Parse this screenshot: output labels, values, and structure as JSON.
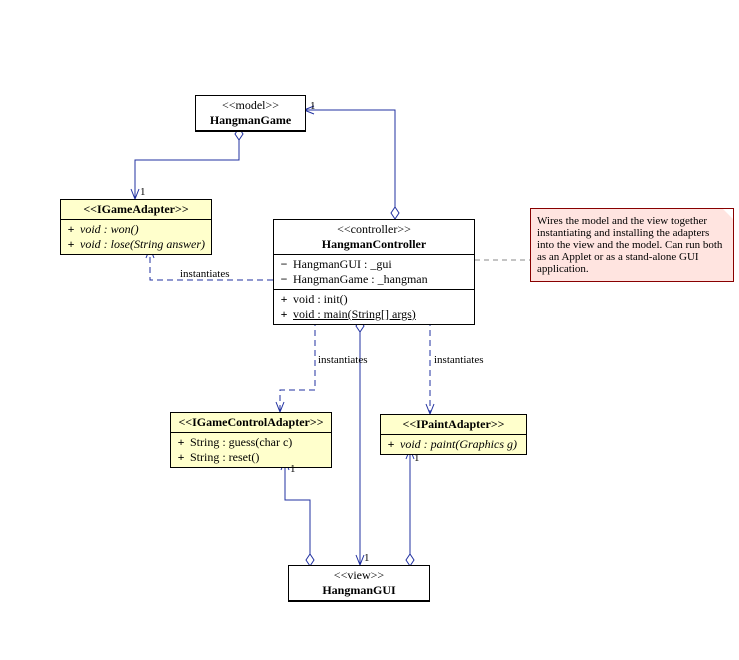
{
  "chart_data": {
    "type": "uml-class-diagram",
    "classes": [
      {
        "id": "HangmanGame",
        "stereotype": "model",
        "sections": [],
        "interface": false
      },
      {
        "id": "HangmanController",
        "stereotype": "controller",
        "sections": [
          {
            "kind": "attributes",
            "items": [
              {
                "vis": "-",
                "text": "HangmanGUI : _gui"
              },
              {
                "vis": "-",
                "text": "HangmanGame : _hangman"
              }
            ]
          },
          {
            "kind": "operations",
            "items": [
              {
                "vis": "+",
                "text": "void : init()"
              },
              {
                "vis": "+",
                "text": "void : main(String[] args)",
                "static": true
              }
            ]
          }
        ],
        "interface": false
      },
      {
        "id": "HangmanGUI",
        "stereotype": "view",
        "sections": [],
        "interface": false
      },
      {
        "id": "IGameAdapter",
        "stereotype": "IGameAdapter",
        "sections": [
          {
            "kind": "operations",
            "items": [
              {
                "vis": "+",
                "text": "void : won()",
                "abstract": true
              },
              {
                "vis": "+",
                "text": "void : lose(String answer)",
                "abstract": true
              }
            ]
          }
        ],
        "interface": true
      },
      {
        "id": "IGameControlAdapter",
        "stereotype": "IGameControlAdapter",
        "sections": [
          {
            "kind": "operations",
            "items": [
              {
                "vis": "+",
                "text": "String : guess(char c)"
              },
              {
                "vis": "+",
                "text": "String : reset()"
              }
            ]
          }
        ],
        "interface": true
      },
      {
        "id": "IPaintAdapter",
        "stereotype": "IPaintAdapter",
        "sections": [
          {
            "kind": "operations",
            "items": [
              {
                "vis": "+",
                "text": "void : paint(Graphics g)",
                "abstract": true
              }
            ]
          }
        ],
        "interface": true
      }
    ],
    "note": "Wires the model and the view together instantiating and installing the adapters into the view and the model.  Can run both as an Applet or as a stand-alone GUI application.",
    "relationships": [
      {
        "from": "HangmanGame",
        "to": "IGameAdapter",
        "type": "aggregation",
        "multiplicity": "1"
      },
      {
        "from": "HangmanController",
        "to": "HangmanGame",
        "type": "aggregation",
        "multiplicity": "1"
      },
      {
        "from": "HangmanController",
        "to": "IGameAdapter",
        "type": "dependency",
        "label": "instantiates"
      },
      {
        "from": "HangmanController",
        "to": "IGameControlAdapter",
        "type": "dependency",
        "label": "instantiates"
      },
      {
        "from": "HangmanController",
        "to": "IPaintAdapter",
        "type": "dependency",
        "label": "instantiates"
      },
      {
        "from": "HangmanController",
        "to": "HangmanGUI",
        "type": "aggregation",
        "multiplicity": "1"
      },
      {
        "from": "HangmanGUI",
        "to": "IGameControlAdapter",
        "type": "aggregation",
        "multiplicity": "1"
      },
      {
        "from": "HangmanGUI",
        "to": "IPaintAdapter",
        "type": "aggregation",
        "multiplicity": "1"
      },
      {
        "from": "HangmanController",
        "to": "note",
        "type": "note-anchor"
      }
    ]
  },
  "hangmanGame": {
    "stereo": "<<model>>",
    "name": "HangmanGame"
  },
  "igameAdapter": {
    "stereo": "<<IGameAdapter>>",
    "m0": "void : won()",
    "m1": "void : lose(String answer)"
  },
  "controller": {
    "stereo": "<<controller>>",
    "name": "HangmanController",
    "a0": "HangmanGUI : _gui",
    "a1": "HangmanGame : _hangman",
    "m0": "void : init()",
    "m1": "void : main(String[] args)"
  },
  "igameControl": {
    "stereo": "<<IGameControlAdapter>>",
    "m0": "String : guess(char c)",
    "m1": "String : reset()"
  },
  "ipaint": {
    "stereo": "<<IPaintAdapter>>",
    "m0": "void : paint(Graphics g)"
  },
  "gui": {
    "stereo": "<<view>>",
    "name": "HangmanGUI"
  },
  "note": "Wires the model and the view together instantiating and installing the adapters into the view and the model.  Can run both as an Applet or as a stand-alone GUI application.",
  "labels": {
    "inst": "instantiates",
    "one": "1"
  },
  "vis": {
    "plus": "+",
    "minus": "−"
  }
}
